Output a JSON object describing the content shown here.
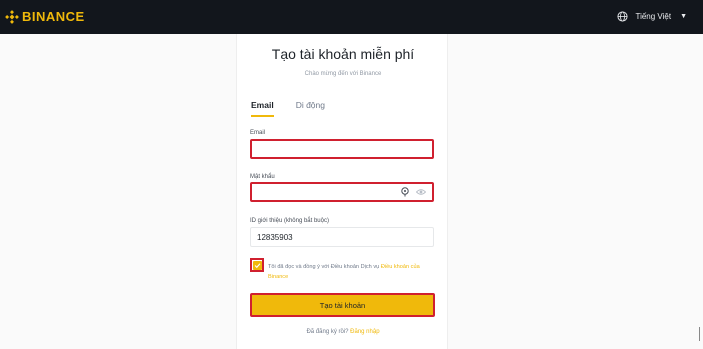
{
  "header": {
    "brand": "BINANCE",
    "language": "Tiếng Việt"
  },
  "form": {
    "title": "Tạo tài khoản miễn phí",
    "subtitle": "Chào mừng đến với Binance",
    "tabs": [
      {
        "label": "Email",
        "active": true
      },
      {
        "label": "Di động",
        "active": false
      }
    ],
    "email_label": "Email",
    "email_value": "",
    "password_label": "Mật khẩu",
    "password_value": "",
    "referral_label": "ID giới thiệu (không bắt buộc)",
    "referral_value": "12835903",
    "terms_text": "Tôi đã đọc và đồng ý với Điều khoản Dịch vụ ",
    "terms_link": "Điều khoản của Binance",
    "terms_checked": true,
    "submit_label": "Tạo tài khoản",
    "login_prompt": "Đã đăng ký rồi? ",
    "login_link": "Đăng nhập"
  },
  "colors": {
    "brand": "#f0b90b",
    "topbar": "#12161c",
    "highlight": "#d0202f"
  }
}
